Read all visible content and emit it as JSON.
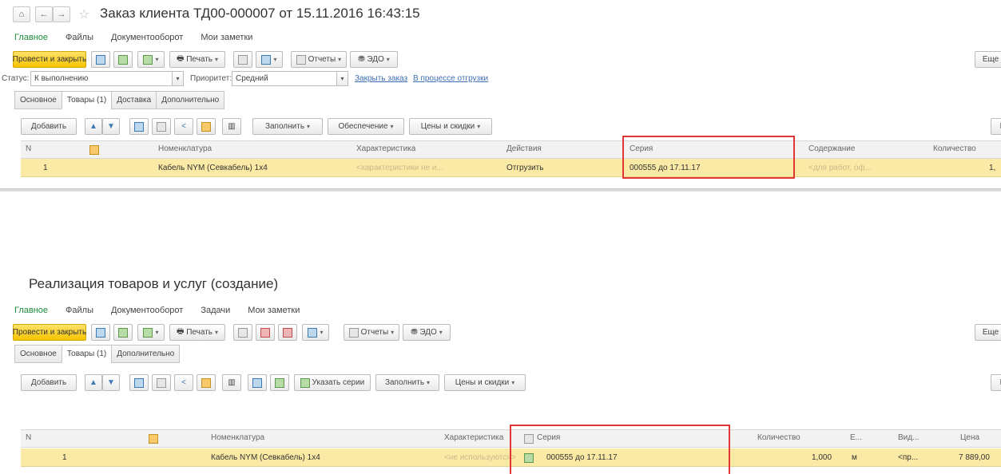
{
  "order": {
    "title": "Заказ клиента ТД00-000007 от 15.11.2016 16:43:15",
    "sections": [
      "Главное",
      "Файлы",
      "Документооборот",
      "Мои заметки"
    ],
    "toolbar": {
      "post_close": "Провести и закрыть",
      "print": "Печать",
      "reports": "Отчеты",
      "edo": "ЭДО",
      "more": "Еще"
    },
    "status_label": "Статус:",
    "status_value": "К выполнению",
    "priority_label": "Приоритет:",
    "priority_value": "Средний",
    "link_close": "Закрыть заказ",
    "link_shipping": "В процессе отгрузки",
    "tabs": [
      "Основное",
      "Товары (1)",
      "Доставка",
      "Дополнительно"
    ],
    "table_toolbar": {
      "add": "Добавить",
      "fill": "Заполнить",
      "supply": "Обеспечение",
      "prices": "Цены и скидки",
      "more_partial": "Е"
    },
    "columns": [
      "N",
      "Номенклатура",
      "Характеристика",
      "Действия",
      "Серия",
      "Содержание",
      "Количество"
    ],
    "row": {
      "n": "1",
      "nomenclature": "Кабель NYM (Севкабель) 1х4",
      "characteristic": "<характеристики не и...",
      "action": "Отгрузить",
      "series": "000555 до 17.11.17",
      "content": "<для работ, оф...",
      "quantity": "1,"
    }
  },
  "sale": {
    "title": "Реализация товаров и услуг (создание)",
    "sections": [
      "Главное",
      "Файлы",
      "Документооборот",
      "Задачи",
      "Мои заметки"
    ],
    "toolbar": {
      "post_close": "Провести и закрыть",
      "print": "Печать",
      "reports": "Отчеты",
      "edo": "ЭДО",
      "more": "Еще"
    },
    "tabs": [
      "Основное",
      "Товары (1)",
      "Дополнительно"
    ],
    "table_toolbar": {
      "add": "Добавить",
      "specify_series": "Указать серии",
      "fill": "Заполнить",
      "prices": "Цены и скидки",
      "more_partial": "Е"
    },
    "columns": [
      "N",
      "Номенклатура",
      "Характеристика",
      "Серия",
      "Количество",
      "Е...",
      "Вид...",
      "Цена"
    ],
    "row": {
      "n": "1",
      "nomenclature": "Кабель NYM (Севкабель) 1х4",
      "characteristic": "<не используются>",
      "series": "000555 до 17.11.17",
      "quantity": "1,000",
      "unit": "м",
      "kind": "<пр...",
      "price": "7 889,00"
    }
  },
  "colors": {
    "accent_green": "#1c8c3a",
    "primary_yellow": "#f5c400",
    "row_highlight": "#fbeaa5",
    "callout_red": "#e03636"
  }
}
